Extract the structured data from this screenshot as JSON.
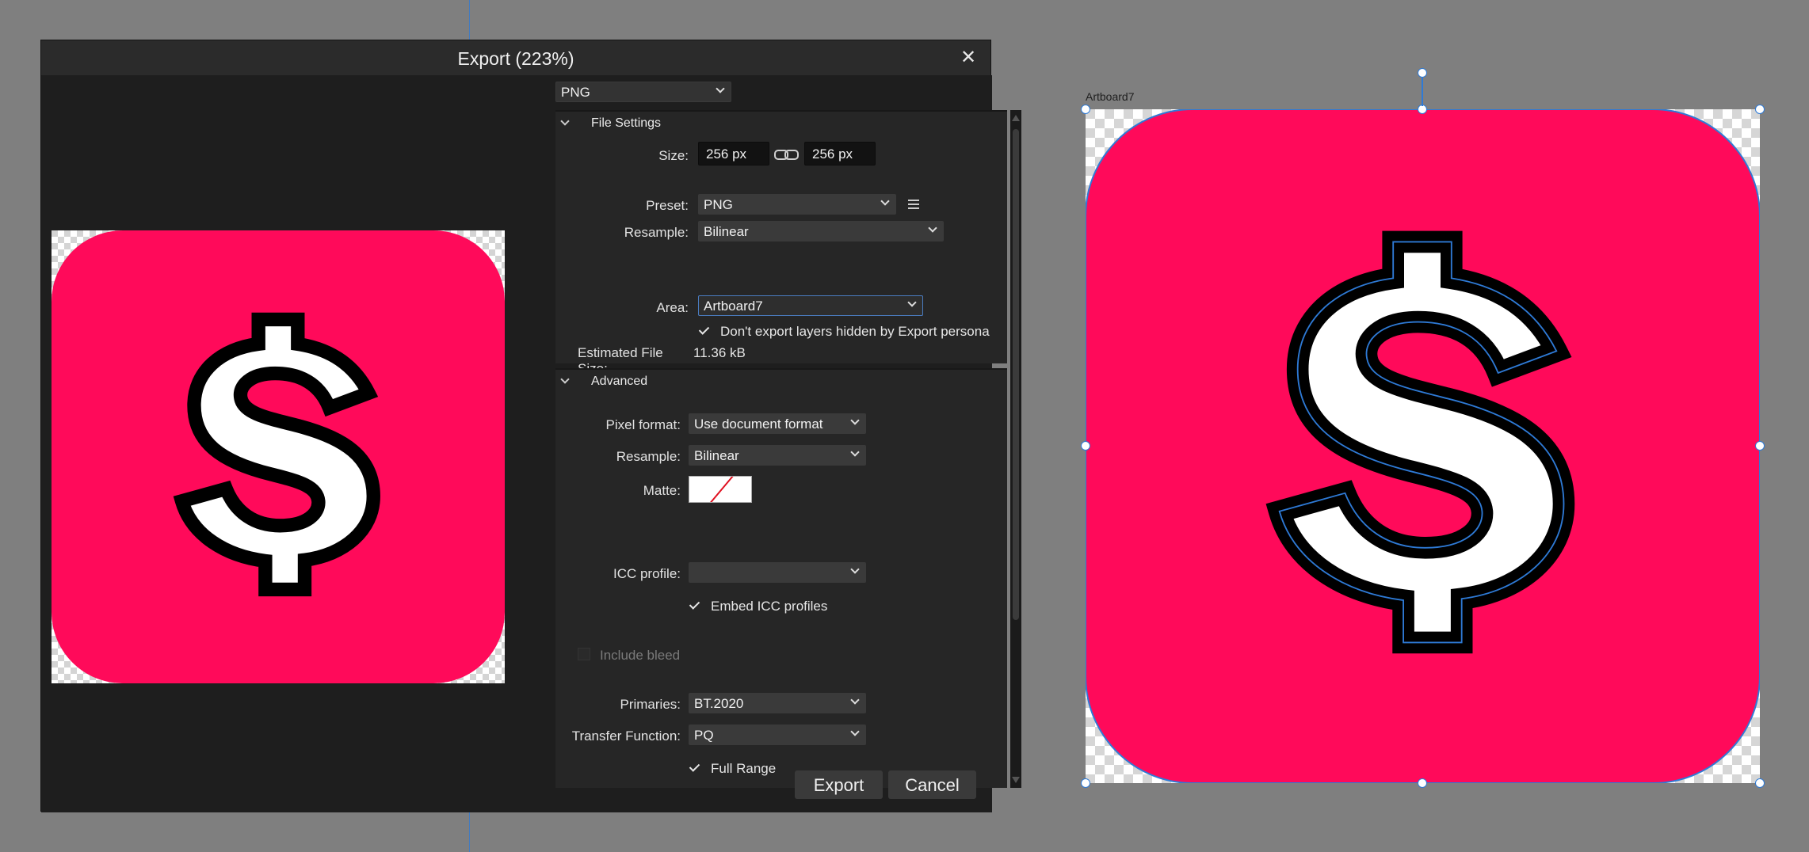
{
  "dialog": {
    "title": "Export (223%)",
    "close_icon": "close-icon",
    "format": "PNG",
    "file_settings": {
      "header": "File Settings",
      "size_label": "Size:",
      "width": "256 px",
      "height": "256 px",
      "preset_label": "Preset:",
      "preset": "PNG",
      "resample_label": "Resample:",
      "resample": "Bilinear",
      "area_label": "Area:",
      "area": "Artboard7",
      "dont_export_hidden": "Don't export layers hidden by Export persona",
      "dont_export_hidden_checked": true,
      "estimated_size_label": "Estimated File Size:",
      "estimated_size": "11.36 kB"
    },
    "advanced": {
      "header": "Advanced",
      "pixel_format_label": "Pixel format:",
      "pixel_format": "Use document format",
      "resample_label": "Resample:",
      "resample": "Bilinear",
      "matte_label": "Matte:",
      "icc_label": "ICC profile:",
      "icc": "",
      "embed_icc": "Embed ICC profiles",
      "embed_icc_checked": true,
      "include_bleed": "Include bleed",
      "include_bleed_checked": false,
      "primaries_label": "Primaries:",
      "primaries": "BT.2020",
      "transfer_label": "Transfer Function:",
      "transfer": "PQ",
      "full_range": "Full Range",
      "full_range_checked": true
    },
    "export_button": "Export",
    "cancel_button": "Cancel"
  },
  "canvas": {
    "artboard_name": "Artboard7"
  },
  "colors": {
    "icon_background": "#ff0a5a",
    "selection": "#2e7ad6",
    "dialog_bg": "#1e1e1e"
  }
}
